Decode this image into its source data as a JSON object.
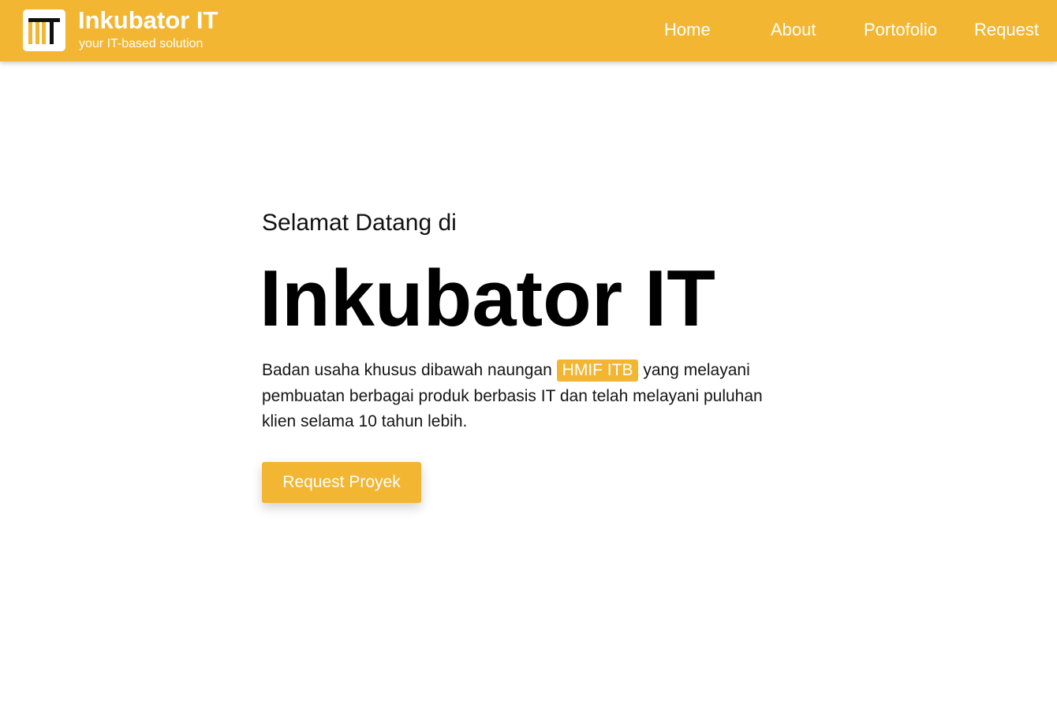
{
  "brand": {
    "title": "Inkubator IT",
    "subtitle": "your IT-based solution",
    "logo_icon": "it-logo-icon"
  },
  "nav": {
    "items": [
      {
        "label": "Home"
      },
      {
        "label": "About"
      },
      {
        "label": "Portofolio"
      },
      {
        "label": "Request"
      }
    ]
  },
  "hero": {
    "pre_title": "Selamat Datang di",
    "title": "Inkubator IT",
    "desc_before": "Badan usaha khusus dibawah naungan",
    "desc_highlight": "HMIF ITB",
    "desc_after": "yang melayani pembuatan berbagai produk berbasis IT dan telah melayani puluhan klien selama 10 tahun lebih.",
    "cta_label": "Request Proyek"
  },
  "colors": {
    "accent": "#f2b632",
    "text": "#000000",
    "background": "#ffffff"
  }
}
